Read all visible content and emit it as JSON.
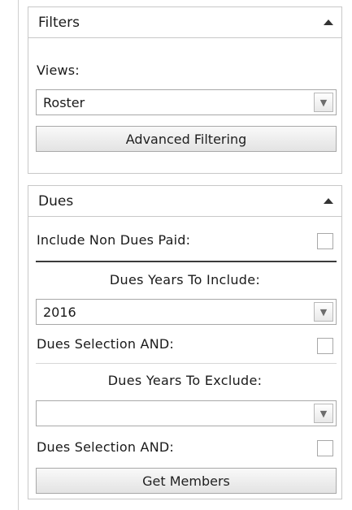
{
  "filters": {
    "title": "Filters",
    "views_label": "Views:",
    "views_select_value": "Roster",
    "advanced_filtering_label": "Advanced Filtering"
  },
  "dues": {
    "title": "Dues",
    "include_non_dues_paid_label": "Include Non Dues Paid:",
    "years_to_include_label": "Dues Years To Include:",
    "years_to_include_value": "2016",
    "selection_and_label_1": "Dues Selection AND:",
    "years_to_exclude_label": "Dues Years To Exclude:",
    "years_to_exclude_value": "",
    "selection_and_label_2": "Dues Selection AND:",
    "get_members_label": "Get Members"
  },
  "icons": {
    "collapse": "collapse-up-icon",
    "dropdown": "dropdown-chevron-icon"
  },
  "colors": {
    "border": "#c8c8c8",
    "button_top": "#f9f9f9",
    "button_bottom": "#e3e3e3",
    "text": "#1a1a1a"
  }
}
